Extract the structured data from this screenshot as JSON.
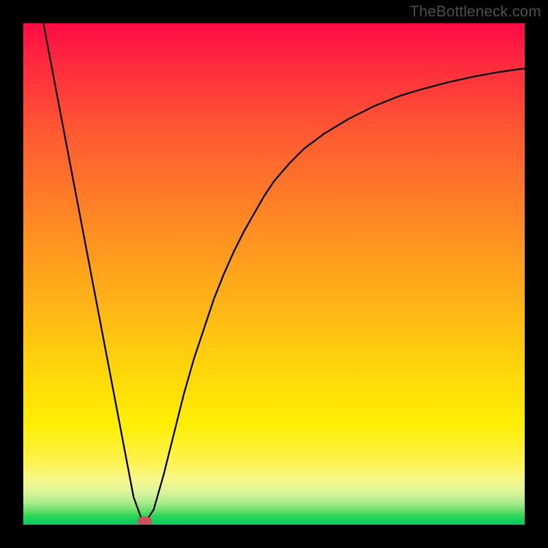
{
  "watermark": "TheBottleneck.com",
  "chart_data": {
    "type": "line",
    "title": "",
    "xlabel": "",
    "ylabel": "",
    "xlim": [
      0,
      100
    ],
    "ylim": [
      0,
      100
    ],
    "grid": false,
    "series": [
      {
        "name": "bottleneck-curve",
        "x": [
          4,
          6,
          8,
          10,
          12,
          14,
          16,
          18,
          20,
          22,
          24,
          26,
          28,
          30,
          32,
          34,
          36,
          38,
          40,
          42,
          44,
          46,
          48,
          50,
          53,
          56,
          60,
          65,
          70,
          75,
          80,
          85,
          90,
          95,
          100
        ],
        "values": [
          100,
          89.5,
          79,
          68.5,
          58,
          47.5,
          37,
          26.5,
          16,
          5.5,
          0,
          3,
          10,
          18,
          26,
          33,
          39,
          45,
          50,
          54.5,
          58.5,
          62,
          65.5,
          68.5,
          72,
          75,
          78,
          81,
          83.5,
          85.5,
          87,
          88.3,
          89.4,
          90.3,
          91
        ]
      }
    ],
    "marker": {
      "x": 24.2,
      "y": 0,
      "color": "#c7555b"
    }
  }
}
